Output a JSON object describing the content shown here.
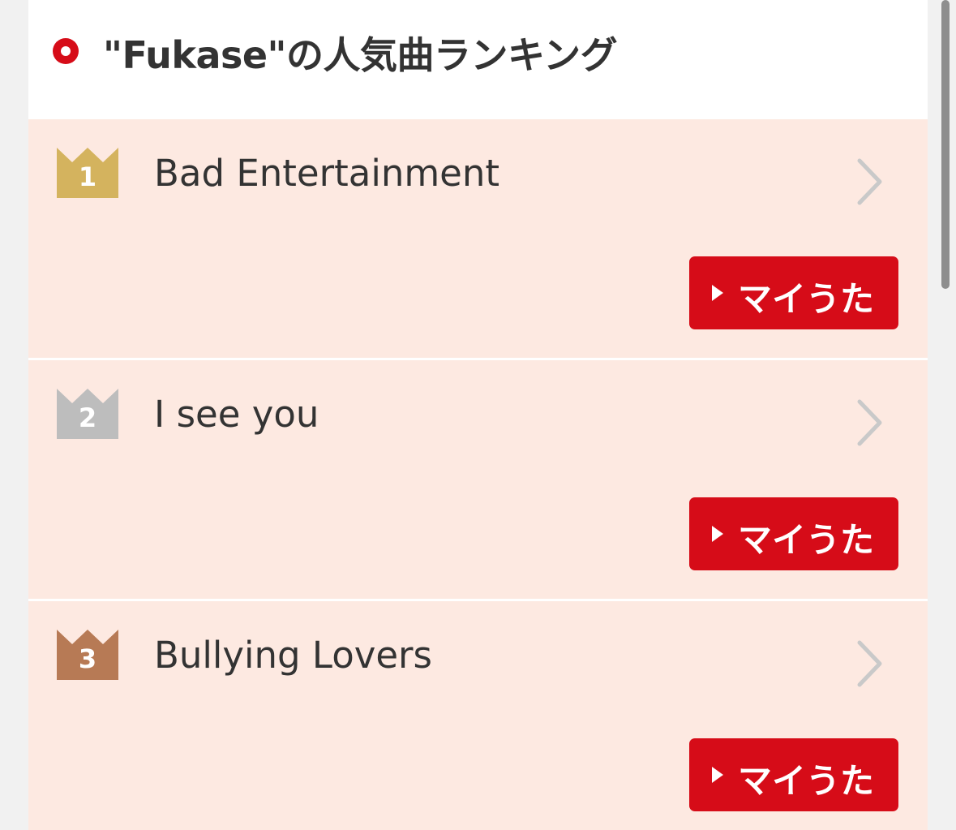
{
  "header": {
    "title": "\"Fukase\"の人気曲ランキング",
    "accent_color": "#d60c18",
    "icon": "record-dot-icon"
  },
  "ranking": [
    {
      "rank": "1",
      "title": "Bad Entertainment",
      "crown_color": "#d4b35e",
      "button_label": "マイうた"
    },
    {
      "rank": "2",
      "title": "I see you",
      "crown_color": "#bdbdbd",
      "button_label": "マイうた"
    },
    {
      "rank": "3",
      "title": "Bullying Lovers",
      "crown_color": "#b77a55",
      "button_label": "マイうた"
    }
  ],
  "colors": {
    "row_background": "#fde9e1",
    "button": "#d60c18"
  }
}
